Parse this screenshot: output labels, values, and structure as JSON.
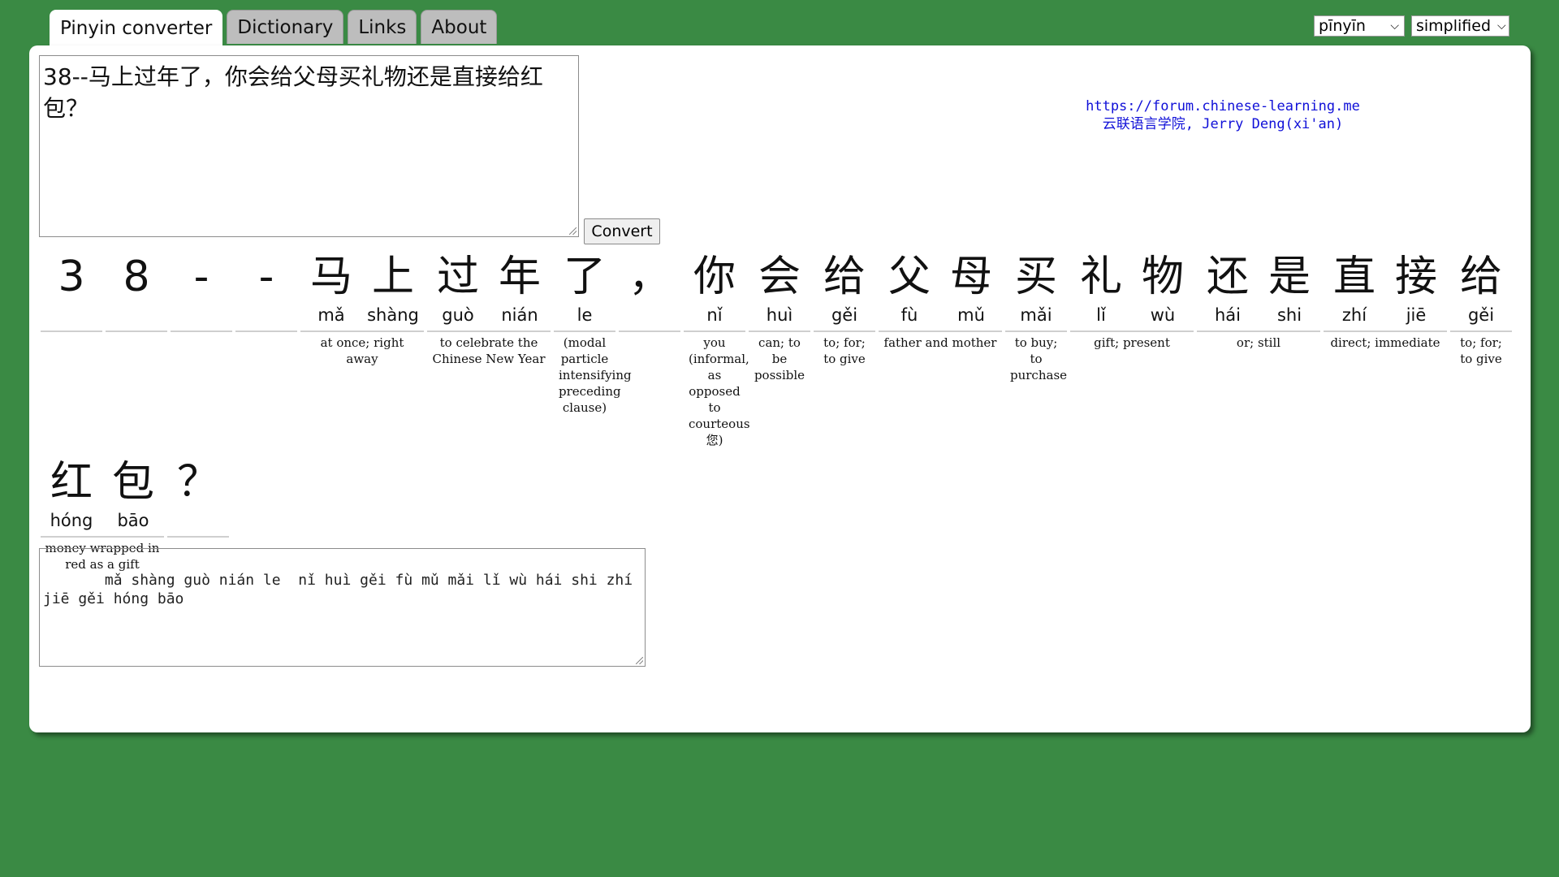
{
  "tabs": [
    {
      "label": "Pinyin converter",
      "active": true
    },
    {
      "label": "Dictionary",
      "active": false
    },
    {
      "label": "Links",
      "active": false
    },
    {
      "label": "About",
      "active": false
    }
  ],
  "options": {
    "tone_style": "pīnyīn",
    "script": "simplified"
  },
  "input_text": "38--马上过年了，你会给父母买礼物还是直接给红包？",
  "convert_label": "Convert",
  "credits": {
    "url": "https://forum.chinese-learning.me",
    "author": "云联语言学院, Jerry Deng(xi'an)"
  },
  "words_row1": [
    {
      "chars": [
        {
          "hz": "3",
          "py": ""
        }
      ],
      "gloss": ""
    },
    {
      "chars": [
        {
          "hz": "8",
          "py": ""
        }
      ],
      "gloss": ""
    },
    {
      "chars": [
        {
          "hz": "-",
          "py": ""
        }
      ],
      "gloss": ""
    },
    {
      "chars": [
        {
          "hz": "-",
          "py": ""
        }
      ],
      "gloss": ""
    },
    {
      "chars": [
        {
          "hz": "马",
          "py": "mǎ"
        },
        {
          "hz": "上",
          "py": "shàng"
        }
      ],
      "gloss": "at once; right away"
    },
    {
      "chars": [
        {
          "hz": "过",
          "py": "guò"
        },
        {
          "hz": "年",
          "py": "nián"
        }
      ],
      "gloss": "to celebrate the Chinese New Year"
    },
    {
      "chars": [
        {
          "hz": "了",
          "py": "le"
        }
      ],
      "gloss": "(modal particle intensifying preceding clause)"
    },
    {
      "chars": [
        {
          "hz": "，",
          "py": ""
        }
      ],
      "gloss": ""
    },
    {
      "chars": [
        {
          "hz": "你",
          "py": "nǐ"
        }
      ],
      "gloss": "you (informal, as opposed to courteous 您)"
    },
    {
      "chars": [
        {
          "hz": "会",
          "py": "huì"
        }
      ],
      "gloss": "can; to be possible"
    },
    {
      "chars": [
        {
          "hz": "给",
          "py": "gěi"
        }
      ],
      "gloss": "to; for; to give"
    },
    {
      "chars": [
        {
          "hz": "父",
          "py": "fù"
        },
        {
          "hz": "母",
          "py": "mǔ"
        }
      ],
      "gloss": "father and mother"
    },
    {
      "chars": [
        {
          "hz": "买",
          "py": "mǎi"
        }
      ],
      "gloss": "to buy; to purchase"
    },
    {
      "chars": [
        {
          "hz": "礼",
          "py": "lǐ"
        },
        {
          "hz": "物",
          "py": "wù"
        }
      ],
      "gloss": "gift; present"
    },
    {
      "chars": [
        {
          "hz": "还",
          "py": "hái"
        },
        {
          "hz": "是",
          "py": "shi"
        }
      ],
      "gloss": "or; still"
    },
    {
      "chars": [
        {
          "hz": "直",
          "py": "zhí"
        },
        {
          "hz": "接",
          "py": "jiē"
        }
      ],
      "gloss": "direct; immediate"
    },
    {
      "chars": [
        {
          "hz": "给",
          "py": "gěi"
        }
      ],
      "gloss": "to; for; to give"
    }
  ],
  "words_row2": [
    {
      "chars": [
        {
          "hz": "红",
          "py": "hóng"
        },
        {
          "hz": "包",
          "py": "bāo"
        }
      ],
      "gloss": "money wrapped in red as a gift"
    },
    {
      "chars": [
        {
          "hz": "？",
          "py": ""
        }
      ],
      "gloss": ""
    }
  ],
  "output_text": "   mǎ shàng guò nián le  nǐ huì gěi fù mǔ mǎi lǐ wù hái shi zhí jiē gěi hóng bāo"
}
